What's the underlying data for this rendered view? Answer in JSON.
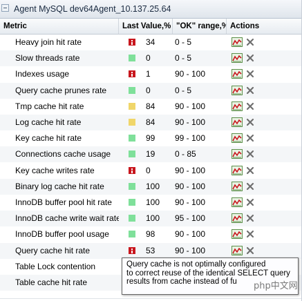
{
  "window": {
    "title": "Agent MySQL dev64Agent_10.137.25.64"
  },
  "columns": {
    "metric": "Metric",
    "last_value": "Last Value,%",
    "ok_range": "\"OK\" range,%",
    "actions": "Actions"
  },
  "rows": [
    {
      "metric": "Heavy join hit rate",
      "status": "critical",
      "value": "34",
      "range": "0 - 5"
    },
    {
      "metric": "Slow threads rate",
      "status": "ok",
      "value": "0",
      "range": "0 - 5"
    },
    {
      "metric": "Indexes usage",
      "status": "critical",
      "value": "1",
      "range": "90 - 100"
    },
    {
      "metric": "Query cache prunes rate",
      "status": "ok",
      "value": "0",
      "range": "0 - 5"
    },
    {
      "metric": "Tmp cache hit rate",
      "status": "warning",
      "value": "84",
      "range": "90 - 100"
    },
    {
      "metric": "Log cache hit rate",
      "status": "warning",
      "value": "84",
      "range": "90 - 100"
    },
    {
      "metric": "Key cache hit rate",
      "status": "ok",
      "value": "99",
      "range": "99 - 100"
    },
    {
      "metric": "Connections cache usage",
      "status": "ok",
      "value": "19",
      "range": "0 - 85"
    },
    {
      "metric": "Key cache writes rate",
      "status": "critical",
      "value": "0",
      "range": "90 - 100"
    },
    {
      "metric": "Binary log cache hit rate",
      "status": "ok",
      "value": "100",
      "range": "90 - 100"
    },
    {
      "metric": "InnoDB buffer pool hit rate",
      "status": "ok",
      "value": "100",
      "range": "90 - 100"
    },
    {
      "metric": "InnoDB cache write wait rate",
      "status": "ok",
      "value": "100",
      "range": "95 - 100"
    },
    {
      "metric": "InnoDB buffer pool usage",
      "status": "ok",
      "value": "98",
      "range": "90 - 100"
    },
    {
      "metric": "Query cache hit rate",
      "status": "critical",
      "value": "53",
      "range": "90 - 100"
    },
    {
      "metric": "Table Lock contention",
      "status": "",
      "value": "",
      "range": ""
    },
    {
      "metric": "Table cache hit rate",
      "status": "",
      "value": "",
      "range": ""
    }
  ],
  "tooltip": {
    "lines": [
      "Query cache is not optimally configured",
      "to correct reuse of the identical SELECT query",
      "results from cache instead of fu"
    ]
  },
  "watermark": "php中文网",
  "colors": {
    "ok": "#7fe09a",
    "warning": "#f0d66a",
    "critical": "#c8161d"
  },
  "icons": {
    "collapse": "minus-box-icon",
    "chart": "chart-icon",
    "remove": "close-x-icon",
    "critical": "exclamation-icon"
  }
}
